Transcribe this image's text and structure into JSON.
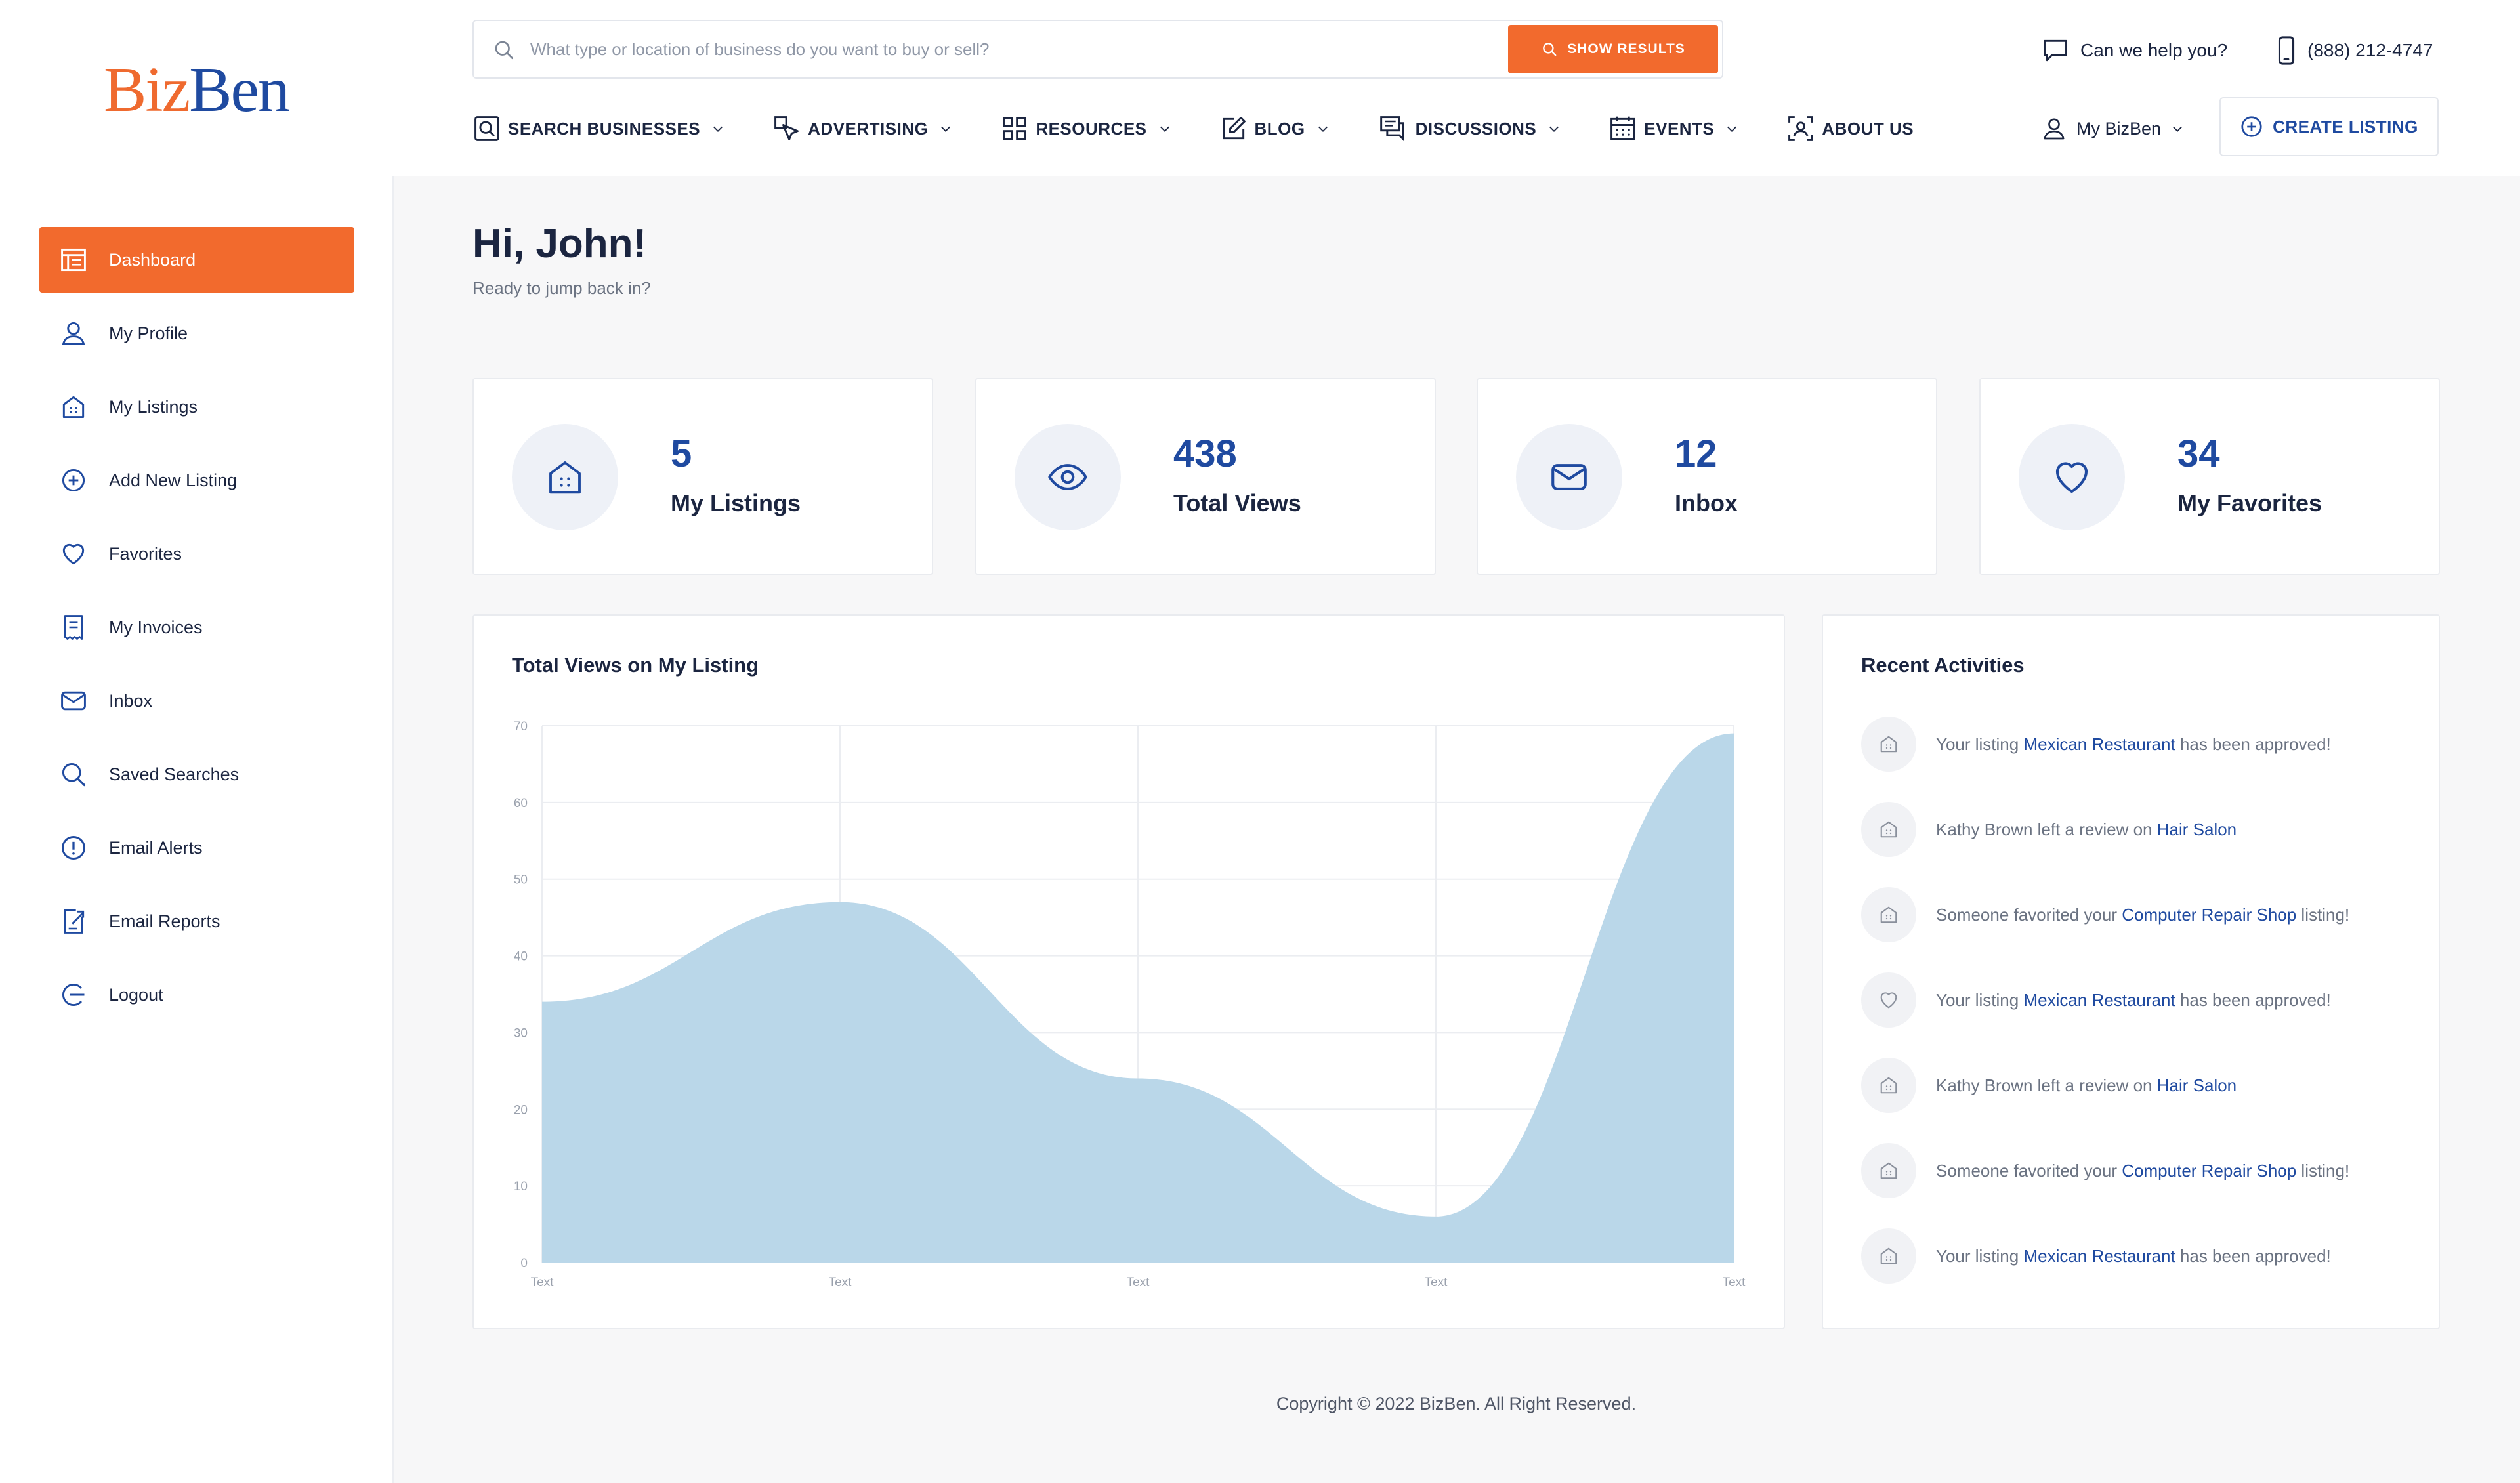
{
  "brand": {
    "part1": "Biz",
    "part2": "Ben"
  },
  "search": {
    "placeholder": "What type or location of business do you want to buy or sell?",
    "button_label": "SHOW RESULTS"
  },
  "contact": {
    "help_label": "Can we help you?",
    "phone": "(888) 212-4747"
  },
  "nav": {
    "items": [
      {
        "label": "SEARCH BUSINESSES",
        "icon": "search-business-icon",
        "has_dropdown": true
      },
      {
        "label": "ADVERTISING",
        "icon": "advertising-icon",
        "has_dropdown": true
      },
      {
        "label": "RESOURCES",
        "icon": "grid-icon",
        "has_dropdown": true
      },
      {
        "label": "BLOG",
        "icon": "edit-icon",
        "has_dropdown": true
      },
      {
        "label": "DISCUSSIONS",
        "icon": "chat-icon",
        "has_dropdown": true
      },
      {
        "label": "EVENTS",
        "icon": "calendar-icon",
        "has_dropdown": true
      },
      {
        "label": "ABOUT US",
        "icon": "about-icon",
        "has_dropdown": false
      }
    ],
    "account_label": "My BizBen",
    "create_listing_label": "CREATE LISTING"
  },
  "sidebar": {
    "items": [
      {
        "label": "Dashboard",
        "icon": "dashboard-icon",
        "active": true
      },
      {
        "label": "My Profile",
        "icon": "user-icon",
        "active": false
      },
      {
        "label": "My Listings",
        "icon": "listing-icon",
        "active": false
      },
      {
        "label": "Add New Listing",
        "icon": "plus-circle-icon",
        "active": false
      },
      {
        "label": "Favorites",
        "icon": "heart-icon",
        "active": false
      },
      {
        "label": "My Invoices",
        "icon": "invoice-icon",
        "active": false
      },
      {
        "label": "Inbox",
        "icon": "mail-icon",
        "active": false
      },
      {
        "label": "Saved Searches",
        "icon": "search-icon",
        "active": false
      },
      {
        "label": "Email Alerts",
        "icon": "alert-icon",
        "active": false
      },
      {
        "label": "Email Reports",
        "icon": "report-icon",
        "active": false
      },
      {
        "label": "Logout",
        "icon": "logout-icon",
        "active": false
      }
    ]
  },
  "main": {
    "greeting": "Hi, John!",
    "subtitle": "Ready to jump back in?",
    "stats": [
      {
        "value": "5",
        "label": "My Listings",
        "icon": "listing-icon"
      },
      {
        "value": "438",
        "label": "Total Views",
        "icon": "eye-icon"
      },
      {
        "value": "12",
        "label": "Inbox",
        "icon": "mail-icon"
      },
      {
        "value": "34",
        "label": "My Favorites",
        "icon": "heart-icon"
      }
    ],
    "chart_title": "Total Views on My Listing"
  },
  "chart_data": {
    "type": "area",
    "title": "Total Views on My Listing",
    "x": [
      "Text",
      "Text",
      "Text",
      "Text",
      "Text"
    ],
    "series": [
      {
        "values": [
          34,
          47,
          24,
          6,
          69
        ]
      }
    ],
    "ylim": [
      0,
      70
    ],
    "yticks": [
      0,
      10,
      20,
      30,
      40,
      50,
      60,
      70
    ],
    "xlabel": "",
    "ylabel": "",
    "grid": true,
    "fill_color": "#bad7e9"
  },
  "activities": {
    "title": "Recent Activities",
    "items": [
      {
        "icon": "listing-icon",
        "prefix": "Your listing ",
        "link": "Mexican Restaurant",
        "suffix": " has been approved!"
      },
      {
        "icon": "listing-icon",
        "prefix": "Kathy Brown left a review on ",
        "link": "Hair Salon",
        "suffix": ""
      },
      {
        "icon": "listing-icon",
        "prefix": "Someone favorited your ",
        "link": "Computer Repair Shop",
        "suffix": " listing!"
      },
      {
        "icon": "heart-icon",
        "prefix": "Your listing ",
        "link": "Mexican Restaurant",
        "suffix": " has been approved!"
      },
      {
        "icon": "listing-icon",
        "prefix": "Kathy Brown left a review on ",
        "link": "Hair Salon",
        "suffix": ""
      },
      {
        "icon": "listing-icon",
        "prefix": "Someone favorited your ",
        "link": "Computer Repair Shop",
        "suffix": " listing!"
      },
      {
        "icon": "listing-icon",
        "prefix": "Your listing ",
        "link": "Mexican Restaurant",
        "suffix": " has been approved!"
      }
    ]
  },
  "footer": {
    "copyright": "Copyright © 2022 BizBen. All Right Reserved."
  },
  "colors": {
    "accent": "#f26a2d",
    "brand_blue": "#1f4aa0",
    "navy": "#1b2540",
    "chart_fill": "#bad7e9"
  }
}
